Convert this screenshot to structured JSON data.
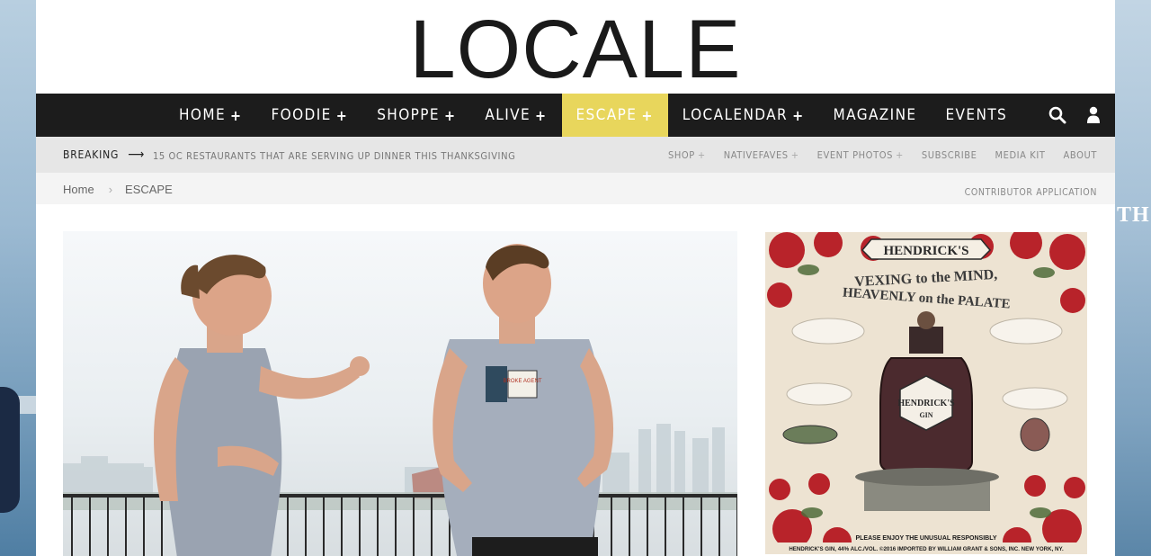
{
  "brand": {
    "logo_text": "LOCALE"
  },
  "main_nav": {
    "items": [
      {
        "label": "HOME",
        "has_submenu": true,
        "active": false
      },
      {
        "label": "FOODIE",
        "has_submenu": true,
        "active": false
      },
      {
        "label": "SHOPPE",
        "has_submenu": true,
        "active": false
      },
      {
        "label": "ALIVE",
        "has_submenu": true,
        "active": false
      },
      {
        "label": "ESCAPE",
        "has_submenu": true,
        "active": true
      },
      {
        "label": "LOCALENDAR",
        "has_submenu": true,
        "active": false
      },
      {
        "label": "MAGAZINE",
        "has_submenu": false,
        "active": false
      },
      {
        "label": "EVENTS",
        "has_submenu": false,
        "active": false
      }
    ],
    "plus": "+",
    "active_color": "#e8d65c",
    "background": "#1c1c1c"
  },
  "breaking": {
    "label": "BREAKING",
    "arrow": "⟶",
    "headline": "15 OC RESTAURANTS THAT ARE SERVING UP DINNER THIS THANKSGIVING"
  },
  "secondary_nav": {
    "items": [
      {
        "label": "SHOP",
        "plus": "+"
      },
      {
        "label": "NATIVEFAVES",
        "plus": "+"
      },
      {
        "label": "EVENT PHOTOS",
        "plus": "+"
      },
      {
        "label": "SUBSCRIBE",
        "plus": ""
      },
      {
        "label": "MEDIA KIT",
        "plus": ""
      },
      {
        "label": "ABOUT",
        "plus": ""
      }
    ]
  },
  "breadcrumb": {
    "home": "Home",
    "separator": "›",
    "current": "ESCAPE"
  },
  "contributor_link": "CONTRIBUTOR APPLICATION",
  "hero": {
    "tshirt_text": "BROKE AGENT"
  },
  "ad": {
    "brand": "HENDRICK'S",
    "tagline_1": "VEXING to the MIND,",
    "tagline_2": "HEAVENLY on the PALATE",
    "bottle_label": "HENDRICK'S",
    "bottle_sub": "GIN",
    "fine_print_1": "PLEASE ENJOY THE UNUSUAL RESPONSIBLY",
    "fine_print_2": "HENDRICK'S GIN, 44% ALC./VOL. ©2016 IMPORTED BY WILLIAM GRANT & SONS, INC. NEW YORK, NY."
  },
  "background_ad": {
    "text": "TH"
  },
  "icons": [
    "search-icon",
    "user-icon"
  ]
}
